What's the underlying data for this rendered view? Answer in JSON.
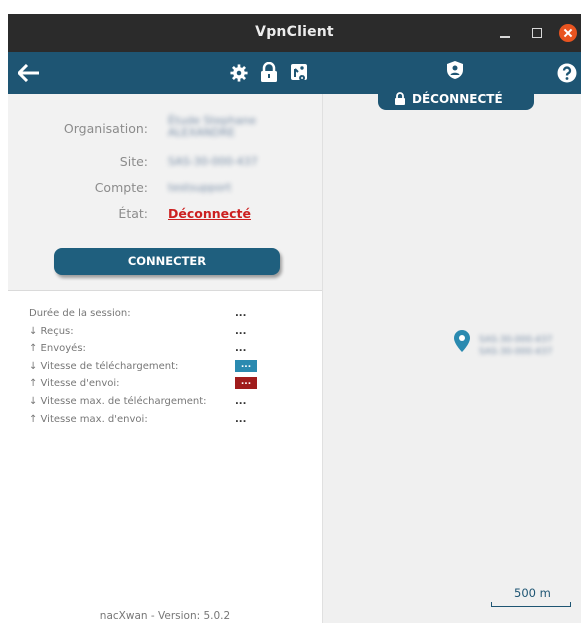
{
  "window": {
    "title": "VpnClient"
  },
  "toolbar": {
    "icons": [
      "back-arrow-icon",
      "gear-icon",
      "lock-icon",
      "route-icon",
      "shield-user-icon",
      "help-icon"
    ],
    "status_tab": "DÉCONNECTÉ"
  },
  "info": {
    "org_label": "Organisation:",
    "site_label": "Site:",
    "account_label": "Compte:",
    "state_label": "État:",
    "state_value": "Déconnecté"
  },
  "connect_button": "CONNECTER",
  "stats": [
    {
      "label": "Durée de la session:",
      "value": "..."
    },
    {
      "label": "↓ Reçus:",
      "value": "..."
    },
    {
      "label": "↑ Envoyés:",
      "value": "..."
    },
    {
      "label": "↓ Vitesse de téléchargement:",
      "value": "..."
    },
    {
      "label": "↑ Vitesse d'envoi:",
      "value": "..."
    },
    {
      "label": "↓ Vitesse max. de téléchargement:",
      "value": "..."
    },
    {
      "label": "↑ Vitesse max. d'envoi:",
      "value": "..."
    }
  ],
  "version": "nacXwan - Version: 5.0.2",
  "map": {
    "scale": "500 m"
  },
  "colors": {
    "primary": "#1e5573",
    "disconnected": "#cc2020",
    "download_badge": "#2a8ab0",
    "upload_badge": "#a01c1c"
  }
}
